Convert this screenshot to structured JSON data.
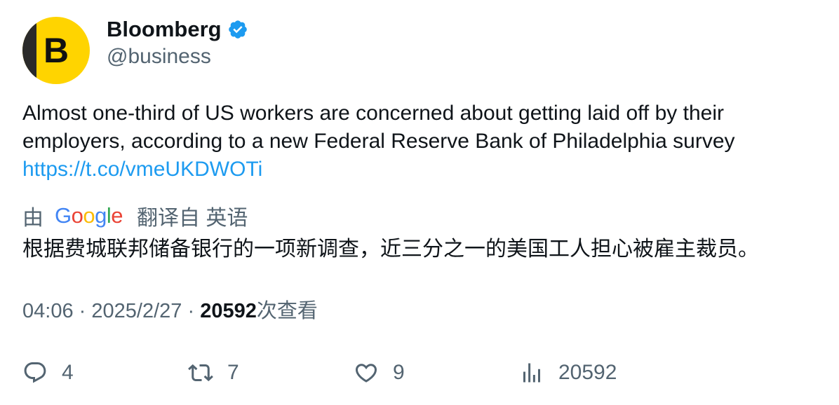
{
  "author": {
    "name": "Bloomberg",
    "handle": "@business",
    "avatar_letter": "B",
    "avatar_color": "#FFD400",
    "verified": true
  },
  "tweet": {
    "text": "Almost one-third of US workers are concerned about getting laid off by their employers, according to a new Federal Reserve Bank of Philadelphia survey",
    "link": "https://t.co/vmeUKDWOTi"
  },
  "translation": {
    "prefix": "由",
    "provider": "Google",
    "suffix": "翻译自 英语",
    "text": "根据费城联邦储备银行的一项新调查，近三分之一的美国工人担心被雇主裁员。"
  },
  "meta": {
    "time": "04:06",
    "separator": "·",
    "date": "2025/2/27",
    "views": "20592",
    "views_label": "次查看"
  },
  "actions": {
    "replies": "4",
    "reposts": "7",
    "likes": "9",
    "views": "20592"
  },
  "colors": {
    "link": "#1d9bf0",
    "secondary_text": "#536471",
    "verified_badge": "#1d9bf0"
  },
  "icons": [
    "verified-badge-icon",
    "reply-icon",
    "repost-icon",
    "like-icon",
    "views-icon"
  ]
}
